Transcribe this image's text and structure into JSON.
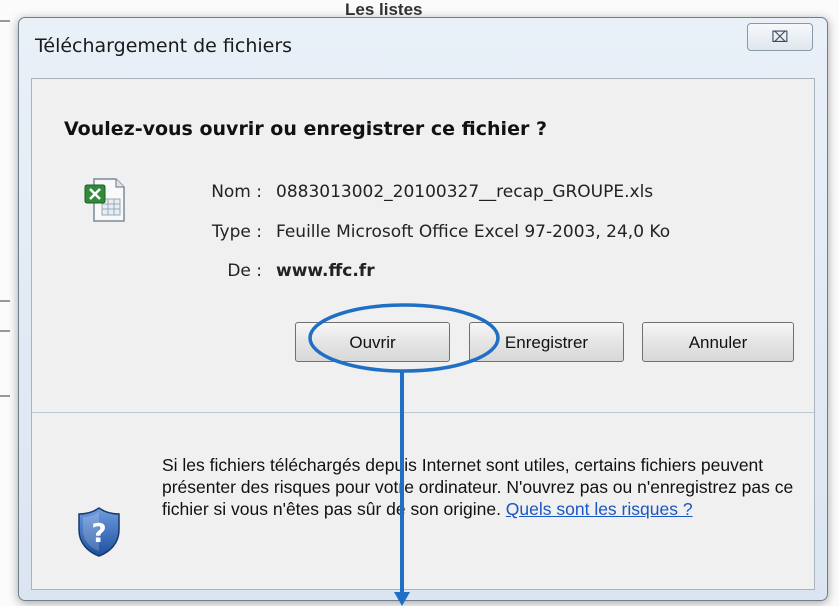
{
  "background": {
    "title": "Les listes"
  },
  "dialog": {
    "title": "Téléchargement de fichiers",
    "close_glyph": "⌧",
    "question": "Voulez-vous ouvrir ou enregistrer ce fichier ?",
    "file": {
      "icon": "excel-file-icon",
      "name_label": "Nom :",
      "name_value": "0883013002_20100327__recap_GROUPE.xls",
      "type_label": "Type :",
      "type_value": "Feuille Microsoft Office Excel 97-2003, 24,0 Ko",
      "from_label": "De :",
      "from_value": "www.ffc.fr"
    },
    "buttons": {
      "open": "Ouvrir",
      "save": "Enregistrer",
      "cancel": "Annuler"
    },
    "warning": {
      "icon": "shield-question-icon",
      "text": "Si les fichiers téléchargés depuis Internet sont utiles, certains fichiers peuvent présenter des risques pour votre ordinateur. N'ouvrez pas ou n'enregistrez pas ce fichier si vous n'êtes pas sûr de son origine. ",
      "link": "Quels sont les risques ?"
    }
  },
  "annotation": {
    "highlight_target": "Ouvrir",
    "color": "#1f6fc4"
  }
}
